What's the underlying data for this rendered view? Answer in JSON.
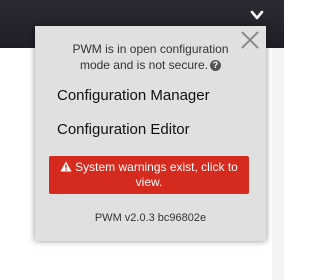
{
  "header": {
    "menu_icon": "chevron-down-icon"
  },
  "popup": {
    "notice_line1": "PWM is in open configuration",
    "notice_line2": "mode and is not secure.",
    "help_icon": "question-circle-icon",
    "close_icon": "close-icon",
    "menu": [
      {
        "label": "Configuration Manager"
      },
      {
        "label": "Configuration Editor"
      }
    ],
    "warning": {
      "icon": "warning-triangle-icon",
      "line1": "System warnings exist, click to",
      "line2": "view.",
      "color": "#d52b1e"
    },
    "version": "PWM v2.0.3 bc96802e"
  }
}
